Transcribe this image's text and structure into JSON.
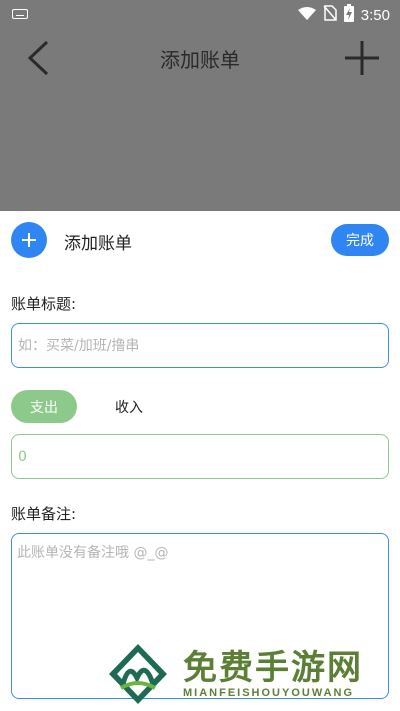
{
  "status_bar": {
    "time": "3:50"
  },
  "nav": {
    "title": "添加账单"
  },
  "sheet": {
    "title": "添加账单",
    "done_label": "完成",
    "bill_title_label": "账单标题:",
    "bill_title_placeholder": "如：买菜/加班/撸串",
    "type_tabs": {
      "expense": "支出",
      "income": "收入",
      "selected": "支出"
    },
    "amount_value": "0",
    "note_label": "账单备注:",
    "note_placeholder": "此账单没有备注哦 @_@"
  },
  "watermark": {
    "cn": "免费手游网",
    "en": "MIANFEISHOUYOUWANG"
  },
  "colors": {
    "accent": "#2f86f2",
    "expense_green": "#8cc98a",
    "overlay": "#7a7a7a",
    "watermark": "#5b7f34"
  }
}
